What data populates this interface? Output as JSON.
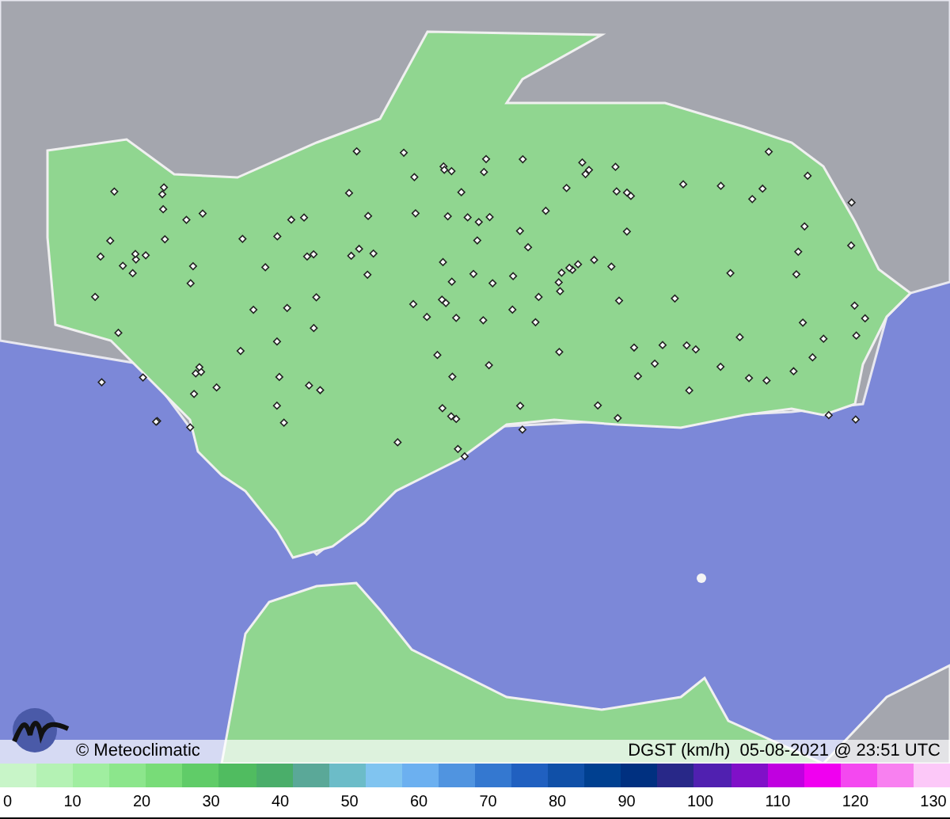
{
  "credit": "© Meteoclimatic",
  "caption": "DGST (km/h)  05-08-2021 @ 23:51 UTC",
  "scale": {
    "swatches": [
      {
        "color": "#c8f5c8"
      },
      {
        "color": "#b4f2b4"
      },
      {
        "color": "#a0eea0"
      },
      {
        "color": "#8ce68c"
      },
      {
        "color": "#78dc78"
      },
      {
        "color": "#60cc68"
      },
      {
        "color": "#50bc60"
      },
      {
        "color": "#4aae6a"
      },
      {
        "color": "#5aa898"
      },
      {
        "color": "#6cbcc8"
      },
      {
        "color": "#80c4f0"
      },
      {
        "color": "#6cb0f0"
      },
      {
        "color": "#5094e0"
      },
      {
        "color": "#3478d0"
      },
      {
        "color": "#2060c0"
      },
      {
        "color": "#1050a8"
      },
      {
        "color": "#004090"
      },
      {
        "color": "#003080"
      },
      {
        "color": "#282888"
      },
      {
        "color": "#5020b0"
      },
      {
        "color": "#8010c8"
      },
      {
        "color": "#c000e0"
      },
      {
        "color": "#f000f0"
      },
      {
        "color": "#f448f0"
      },
      {
        "color": "#f880f0"
      },
      {
        "color": "#fcc8f8"
      }
    ],
    "labels": [
      "0",
      "10",
      "20",
      "30",
      "40",
      "50",
      "60",
      "70",
      "80",
      "90",
      "100",
      "110",
      "120",
      "130"
    ]
  }
}
